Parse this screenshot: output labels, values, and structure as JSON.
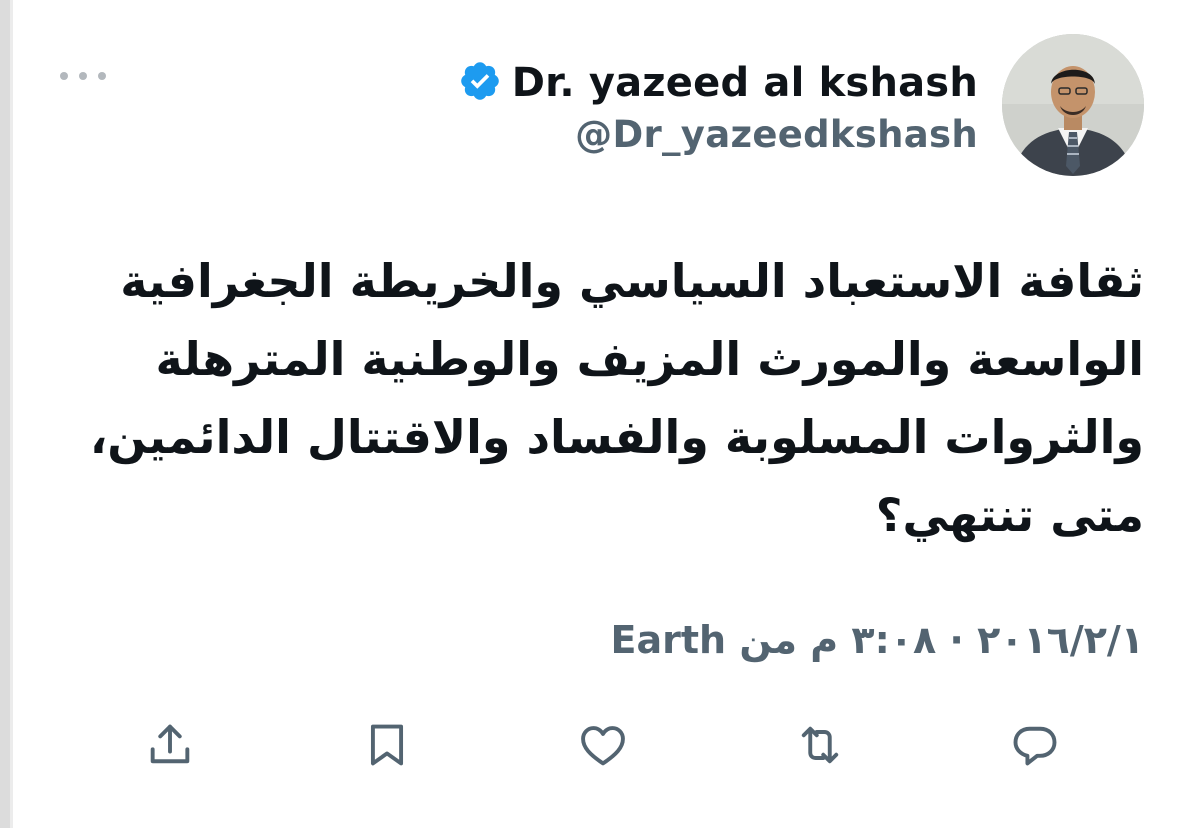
{
  "author": {
    "display_name": "Dr. yazeed al kshash",
    "handle": "@Dr_yazeedkshash",
    "verified": true
  },
  "tweet": {
    "text": "ثقافة الاستعباد السياسي والخريطة الجغرافية الواسعة والمورث المزيف والوطنية المترهلة والثروات المسلوبة والفساد والاقتتال الدائمين، متى تنتهي؟",
    "date": "٢٠١٦/٢/١",
    "separator": "·",
    "time": "٣:٠٨ م",
    "source_prefix": "من",
    "source": "Earth"
  },
  "icons": {
    "more": "more-icon",
    "verified": "verified-badge-icon",
    "share": "share-icon",
    "bookmark": "bookmark-icon",
    "like": "heart-icon",
    "retweet": "retweet-icon",
    "reply": "reply-icon"
  },
  "colors": {
    "text": "#0f1419",
    "secondary": "#536471",
    "verified": "#1d9bf0",
    "icon": "#536471"
  }
}
